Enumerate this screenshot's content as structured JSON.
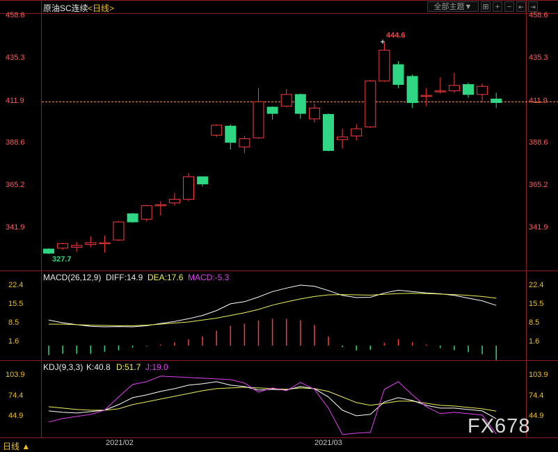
{
  "header": {
    "instrument": "原油SC连续",
    "period": "<日线>",
    "dropdown_label": "全部主题▼",
    "toolbar_icons": [
      "grid-icon",
      "add-icon",
      "minus-icon",
      "first-page-icon",
      "next-page-icon"
    ]
  },
  "main_axis": {
    "ticks": [
      "458.6",
      "435.3",
      "411.9",
      "388.6",
      "365.2",
      "341.9"
    ]
  },
  "price_labels": {
    "high": "444.6",
    "low": "327.7"
  },
  "macd": {
    "title": "MACD(26,12,9)",
    "diff_label": "DIFF:14.9",
    "dea_label": "DEA:17.6",
    "macd_label": "MACD:-5.3",
    "ticks": [
      "22.4",
      "15.5",
      "8.5",
      "1.6"
    ]
  },
  "kdj": {
    "title": "KDJ(9,3,3)",
    "k_label": "K:40.8",
    "d_label": "D:51.7",
    "j_label": "J:19.0",
    "ticks": [
      "103.9",
      "74.4",
      "44.9"
    ]
  },
  "x_axis": {
    "labels": [
      "2021/02",
      "2021/03"
    ]
  },
  "footer": {
    "period_tab": "日线 ▲",
    "watermark": "FX678"
  },
  "colors": {
    "up": "#ff3c3c",
    "down": "#2fd683",
    "axis_text": "#ff5a5a",
    "last_price_line": "#ff8c40",
    "diff_line": "#ffffff",
    "dea_line": "#f0f05a",
    "j_line": "#e040f0"
  },
  "chart_data": [
    {
      "type": "candlestick",
      "title": "原油SC连续 <日线>",
      "ylim": [
        327.7,
        458.6
      ],
      "yticks": [
        458.6,
        435.3,
        411.9,
        388.6,
        365.2,
        341.9
      ],
      "last_price": 411.9,
      "annotations": [
        {
          "label": "444.6",
          "kind": "high"
        },
        {
          "label": "327.7",
          "kind": "low"
        }
      ],
      "x_labels": [
        {
          "label": "2021/02",
          "index": 4
        },
        {
          "label": "2021/03",
          "index": 19
        }
      ],
      "candles": [
        {
          "o": 330.5,
          "h": 331.0,
          "l": 327.7,
          "c": 328.2
        },
        {
          "o": 331.0,
          "h": 334.0,
          "l": 330.0,
          "c": 333.5
        },
        {
          "o": 331.5,
          "h": 334.5,
          "l": 329.0,
          "c": 332.5
        },
        {
          "o": 333.0,
          "h": 337.5,
          "l": 331.5,
          "c": 334.0
        },
        {
          "o": 334.0,
          "h": 338.0,
          "l": 328.5,
          "c": 334.0
        },
        {
          "o": 335.5,
          "h": 346.0,
          "l": 335.0,
          "c": 345.5
        },
        {
          "o": 350.0,
          "h": 350.5,
          "l": 345.0,
          "c": 345.5
        },
        {
          "o": 347.0,
          "h": 355.0,
          "l": 346.0,
          "c": 354.5
        },
        {
          "o": 354.5,
          "h": 357.0,
          "l": 349.0,
          "c": 355.0
        },
        {
          "o": 356.0,
          "h": 361.5,
          "l": 354.5,
          "c": 358.0
        },
        {
          "o": 358.0,
          "h": 372.5,
          "l": 357.0,
          "c": 370.5
        },
        {
          "o": 370.5,
          "h": 370.5,
          "l": 365.0,
          "c": 366.5
        },
        {
          "o": 393.5,
          "h": 399.5,
          "l": 392.5,
          "c": 399.0
        },
        {
          "o": 398.5,
          "h": 399.5,
          "l": 385.5,
          "c": 389.5
        },
        {
          "o": 387.0,
          "h": 393.0,
          "l": 383.5,
          "c": 391.5
        },
        {
          "o": 392.0,
          "h": 419.5,
          "l": 391.5,
          "c": 412.0
        },
        {
          "o": 409.0,
          "h": 409.5,
          "l": 402.0,
          "c": 405.5
        },
        {
          "o": 409.5,
          "h": 419.0,
          "l": 409.0,
          "c": 416.0
        },
        {
          "o": 416.0,
          "h": 416.5,
          "l": 402.5,
          "c": 405.5
        },
        {
          "o": 402.5,
          "h": 411.0,
          "l": 400.5,
          "c": 408.5
        },
        {
          "o": 405.0,
          "h": 405.5,
          "l": 384.5,
          "c": 385.0
        },
        {
          "o": 391.0,
          "h": 397.0,
          "l": 386.0,
          "c": 392.5
        },
        {
          "o": 393.0,
          "h": 399.5,
          "l": 390.5,
          "c": 397.0
        },
        {
          "o": 398.0,
          "h": 424.0,
          "l": 397.5,
          "c": 423.5
        },
        {
          "o": 423.5,
          "h": 444.6,
          "l": 423.0,
          "c": 440.5
        },
        {
          "o": 432.5,
          "h": 434.5,
          "l": 419.5,
          "c": 421.5
        },
        {
          "o": 426.0,
          "h": 427.0,
          "l": 408.5,
          "c": 411.5
        },
        {
          "o": 415.5,
          "h": 419.5,
          "l": 409.5,
          "c": 415.5
        },
        {
          "o": 417.5,
          "h": 425.5,
          "l": 416.5,
          "c": 418.0
        },
        {
          "o": 418.0,
          "h": 428.0,
          "l": 417.0,
          "c": 421.0
        },
        {
          "o": 421.5,
          "h": 422.5,
          "l": 414.0,
          "c": 416.0
        },
        {
          "o": 416.0,
          "h": 422.0,
          "l": 411.5,
          "c": 420.5
        },
        {
          "o": 413.5,
          "h": 417.0,
          "l": 408.5,
          "c": 411.5
        }
      ]
    },
    {
      "type": "line",
      "title": "MACD(26,12,9)",
      "ylim": [
        1.6,
        22.4
      ],
      "yticks": [
        22.4,
        15.5,
        8.5,
        1.6
      ],
      "series": [
        {
          "name": "DIFF",
          "values": [
            9.5,
            8.5,
            7.8,
            7.2,
            7.0,
            7.1,
            7.0,
            7.4,
            8.2,
            9.0,
            10.0,
            11.2,
            13.0,
            15.5,
            16.3,
            18.0,
            20.0,
            21.3,
            22.4,
            22.0,
            20.4,
            18.6,
            17.8,
            17.9,
            19.5,
            20.5,
            20.0,
            19.5,
            19.2,
            18.6,
            17.6,
            16.6,
            14.9
          ]
        },
        {
          "name": "DEA",
          "values": [
            8.0,
            8.0,
            7.8,
            7.6,
            7.5,
            7.4,
            7.4,
            7.6,
            8.0,
            8.4,
            8.8,
            9.5,
            10.2,
            11.2,
            12.2,
            13.4,
            15.0,
            16.2,
            17.3,
            18.2,
            18.8,
            18.9,
            18.8,
            18.7,
            19.0,
            19.3,
            19.4,
            19.3,
            19.1,
            18.9,
            18.6,
            18.2,
            17.6
          ]
        },
        {
          "name": "MACD",
          "values": [
            -3.5,
            -3.0,
            -3.0,
            -3.0,
            -2.3,
            -1.7,
            -0.7,
            -0.2,
            0.4,
            1.2,
            2.3,
            3.4,
            5.5,
            7.3,
            8.1,
            9.3,
            9.9,
            9.8,
            9.4,
            7.6,
            3.3,
            -0.6,
            -1.8,
            -1.6,
            1.0,
            2.4,
            1.3,
            0.4,
            -0.9,
            -1.7,
            -2.4,
            -3.2,
            -5.3
          ]
        }
      ]
    },
    {
      "type": "line",
      "title": "KDJ(9,3,3)",
      "ylim": [
        30,
        103.9
      ],
      "yticks": [
        103.9,
        74.4,
        44.9
      ],
      "series": [
        {
          "name": "K",
          "values": [
            52,
            50,
            49,
            51,
            53,
            61,
            71,
            75,
            80,
            84,
            89,
            91,
            94,
            89,
            87,
            82,
            83,
            82,
            87,
            84,
            72,
            53,
            45,
            47,
            65,
            71,
            67,
            60,
            56,
            56,
            54,
            52,
            40.8
          ]
        },
        {
          "name": "D",
          "values": [
            58,
            56,
            54,
            53,
            53,
            55,
            61,
            65,
            69,
            73,
            77,
            81,
            84,
            85,
            86,
            85,
            84,
            83,
            85,
            84,
            80,
            72,
            64,
            60,
            63,
            66,
            66,
            63,
            60,
            59,
            57,
            55,
            51.7
          ]
        },
        {
          "name": "J",
          "values": [
            36,
            41,
            44,
            47,
            53,
            72,
            90,
            94,
            102,
            101,
            100,
            99,
            98,
            97,
            92,
            79,
            85,
            81,
            93,
            83,
            56,
            18,
            20,
            21,
            83,
            94,
            75,
            58,
            48,
            50,
            48,
            46,
            19.0
          ]
        }
      ]
    }
  ]
}
